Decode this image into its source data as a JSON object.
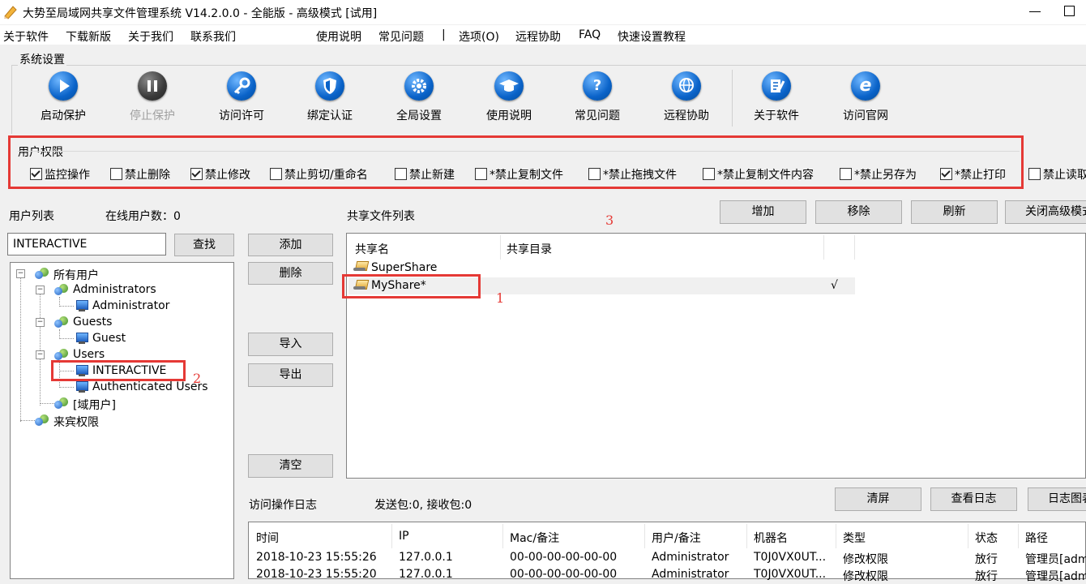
{
  "window": {
    "title": "大势至局域网共享文件管理系统 V14.2.0.0 - 全能版 - 高级模式 [试用]"
  },
  "menu": [
    "关于软件",
    "下载新版",
    "关于我们",
    "联系我们",
    "使用说明",
    "常见问题",
    "|",
    "选项(O)",
    "远程协助",
    "FAQ",
    "快速设置教程"
  ],
  "system_settings": {
    "title": "系统设置",
    "tools": [
      {
        "label": "启动保护",
        "icon": "play-icon",
        "enabled": true
      },
      {
        "label": "停止保护",
        "icon": "pause-icon",
        "enabled": false
      },
      {
        "label": "访问许可",
        "icon": "key-icon",
        "enabled": true
      },
      {
        "label": "绑定认证",
        "icon": "shield-icon",
        "enabled": true
      },
      {
        "label": "全局设置",
        "icon": "gear-icon",
        "enabled": true
      },
      {
        "label": "使用说明",
        "icon": "graduation-cap-icon",
        "enabled": true
      },
      {
        "label": "常见问题",
        "icon": "question-icon",
        "enabled": true
      },
      {
        "label": "远程协助",
        "icon": "globe-icon",
        "enabled": true
      },
      {
        "label": "关于软件",
        "icon": "document-pen-icon",
        "enabled": true
      },
      {
        "label": "访问官网",
        "icon": "ie-browser-icon",
        "enabled": true
      }
    ]
  },
  "user_permissions": {
    "title": "用户权限",
    "options": [
      {
        "label": "监控操作",
        "checked": true
      },
      {
        "label": "禁止删除",
        "checked": false
      },
      {
        "label": "禁止修改",
        "checked": true
      },
      {
        "label": "禁止剪切/重命名",
        "checked": false
      },
      {
        "label": "禁止新建",
        "checked": false
      },
      {
        "label": "*禁止复制文件",
        "checked": false
      },
      {
        "label": "*禁止拖拽文件",
        "checked": false
      },
      {
        "label": "*禁止复制文件内容",
        "checked": false
      },
      {
        "label": "*禁止另存为",
        "checked": false
      },
      {
        "label": "*禁止打印",
        "checked": true
      },
      {
        "label": "禁止读取",
        "checked": false
      }
    ]
  },
  "user_list": {
    "title": "用户列表",
    "online_label": "在线用户数：0",
    "search_value": "INTERACTIVE",
    "search_button": "查找",
    "tree": {
      "root": "所有用户",
      "administrators": "Administrators",
      "administrator": "Administrator",
      "guests": "Guests",
      "guest": "Guest",
      "users": "Users",
      "interactive": "INTERACTIVE",
      "authenticated": "Authenticated Users",
      "domain_users": "[域用户]",
      "guest_rights": "来宾权限"
    }
  },
  "middle_buttons": {
    "add": "添加",
    "delete": "删除",
    "import": "导入",
    "export": "导出",
    "clear": "清空"
  },
  "share_list": {
    "title": "共享文件列表",
    "buttons": {
      "add": "增加",
      "remove": "移除",
      "refresh": "刷新",
      "close_advanced": "关闭高级模式"
    },
    "columns": [
      "共享名",
      "共享目录"
    ],
    "rows": [
      {
        "name": "SuperShare",
        "dir": "",
        "flag": ""
      },
      {
        "name": "MyShare*",
        "dir": "",
        "flag": "√"
      }
    ]
  },
  "annotations": {
    "mark1": "1",
    "mark2": "2",
    "mark3": "3"
  },
  "log": {
    "title": "访问操作日志",
    "packets": "发送包:0, 接收包:0",
    "buttons": {
      "clear_screen": "清屏",
      "view_log": "查看日志",
      "log_chart": "日志图表"
    },
    "columns": [
      "时间",
      "IP",
      "Mac/备注",
      "用户/备注",
      "机器名",
      "类型",
      "状态",
      "路径"
    ],
    "rows": [
      [
        "2018-10-23 15:55:26",
        "127.0.0.1",
        "00-00-00-00-00-00",
        "Administrator",
        "T0J0VX0UT...",
        "修改权限",
        "放行",
        "管理员[administrator]"
      ],
      [
        "2018-10-23 15:55:20",
        "127.0.0.1",
        "00-00-00-00-00-00",
        "Administrator",
        "T0J0VX0UT...",
        "修改权限",
        "放行",
        "管理员[administrator]"
      ]
    ]
  },
  "colors": {
    "highlight_border": "#e53935",
    "icon_blue": "#0a63c9"
  }
}
